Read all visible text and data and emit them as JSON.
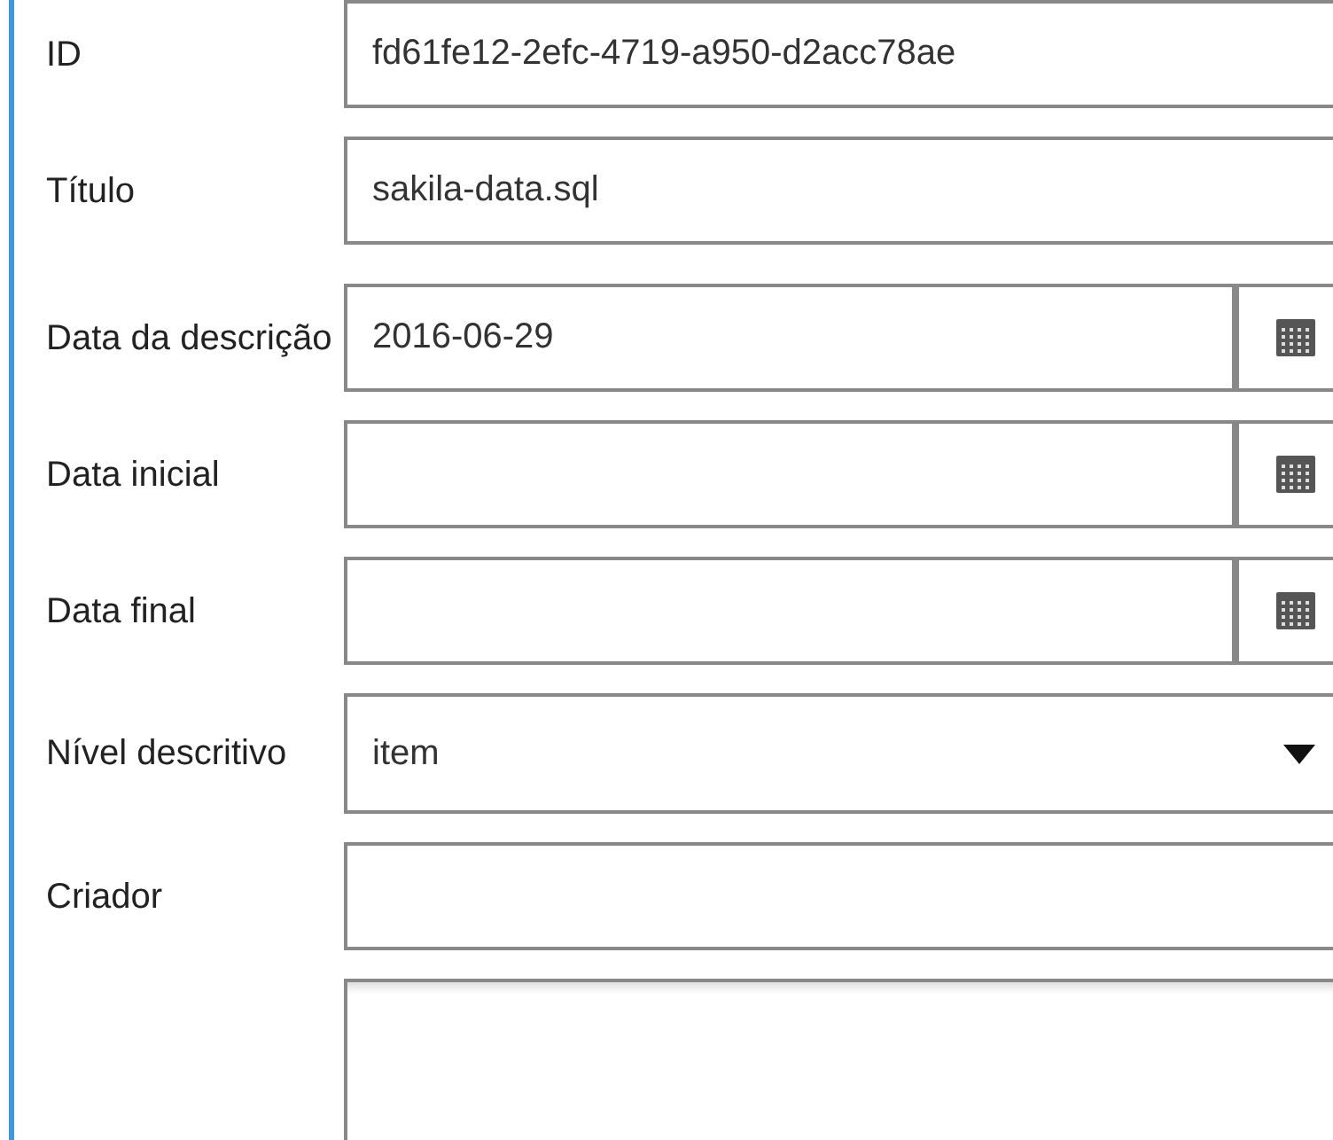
{
  "fields": [
    {
      "kind": "text",
      "label": "ID",
      "value": "fd61fe12-2efc-4719-a950-d2acc78ae"
    },
    {
      "kind": "text",
      "label": "Título",
      "value": "sakila-data.sql"
    },
    {
      "kind": "date",
      "label": "Data da descrição",
      "value": "2016-06-29"
    },
    {
      "kind": "date",
      "label": "Data inicial"
    },
    {
      "kind": "date",
      "label": "Data final"
    },
    {
      "kind": "select",
      "label": "Nível descritivo",
      "value": "item"
    },
    {
      "kind": "text",
      "label": "Criador"
    },
    {
      "kind": "textarea"
    }
  ]
}
